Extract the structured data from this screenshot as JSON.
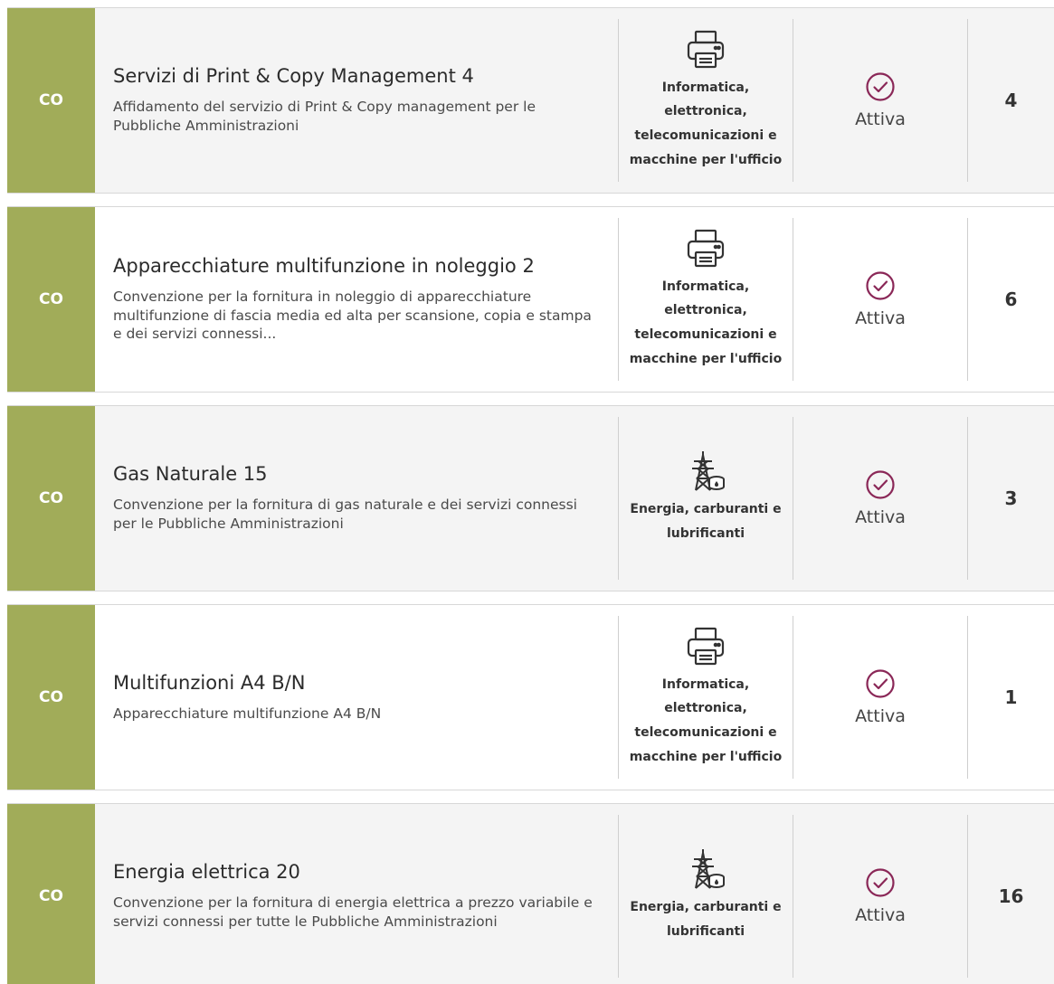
{
  "colors": {
    "tag_bg": "#a1ac59",
    "check_color": "#8a2757"
  },
  "rows": [
    {
      "tag": "CO",
      "title": "Servizi di Print & Copy Management 4",
      "description": "Affidamento del servizio di Print & Copy management per le Pubbliche Amministrazioni",
      "category_icon": "printer-icon",
      "category": "Informatica, elettronica, telecomunicazioni e macchine per l'ufficio",
      "status": "Attiva",
      "count": "4"
    },
    {
      "tag": "CO",
      "title": "Apparecchiature multifunzione in noleggio 2",
      "description": "Convenzione per la fornitura in noleggio di apparecchiature multifunzione di fascia media ed alta per scansione, copia e stampa e dei servizi connessi...",
      "category_icon": "printer-icon",
      "category": "Informatica, elettronica, telecomunicazioni e macchine per l'ufficio",
      "status": "Attiva",
      "count": "6"
    },
    {
      "tag": "CO",
      "title": "Gas Naturale 15",
      "description": "Convenzione per la fornitura di gas naturale e dei servizi connessi per le Pubbliche Amministrazioni",
      "category_icon": "energy-tower-icon",
      "category": "Energia, carburanti e lubrificanti",
      "status": "Attiva",
      "count": "3"
    },
    {
      "tag": "CO",
      "title": "Multifunzioni A4 B/N",
      "description": "Apparecchiature multifunzione A4 B/N",
      "category_icon": "printer-icon",
      "category": "Informatica, elettronica, telecomunicazioni e macchine per l'ufficio",
      "status": "Attiva",
      "count": "1"
    },
    {
      "tag": "CO",
      "title": "Energia elettrica 20",
      "description": "Convenzione per la fornitura di energia elettrica a prezzo variabile e servizi connessi per tutte le Pubbliche Amministrazioni",
      "category_icon": "energy-tower-icon",
      "category": "Energia, carburanti e lubrificanti",
      "status": "Attiva",
      "count": "16"
    }
  ]
}
